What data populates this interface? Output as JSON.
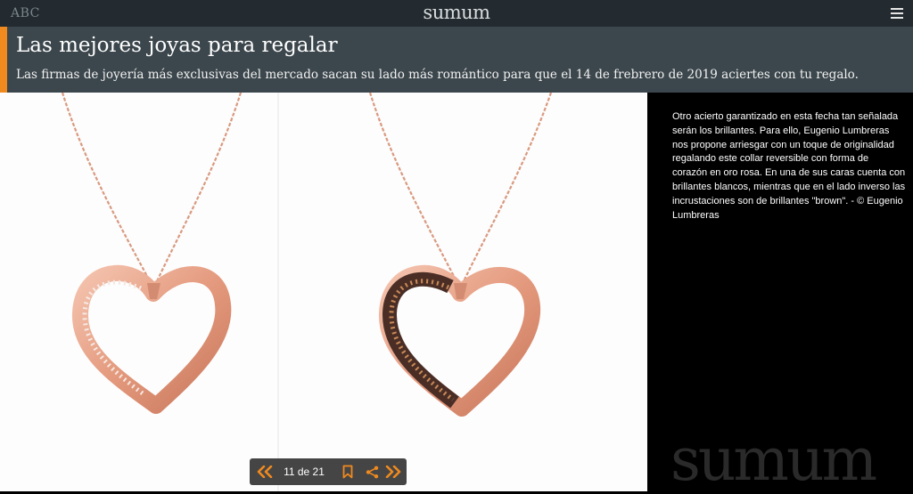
{
  "header": {
    "brand_left": "ABC",
    "brand_center": "sumum",
    "menu_icon": "hamburger-menu-icon"
  },
  "article": {
    "title": "Las mejores joyas para regalar",
    "subtitle": "Las firmas de joyería más exclusivas del mercado sacan su lado más romántico para que el 14 de frebrero de 2019 aciertes con tu regalo."
  },
  "gallery": {
    "caption": "Otro acierto garantizado en esta fecha tan señalada serán los brillantes. Para ello, Eugenio Lumbreras nos propone arriesgar con un toque de originalidad regalando este collar reversible con forma de corazón en oro rosa. En una de sus caras cuenta con brillantes blancos, mientras que en el lado inverso las incrustaciones son de brillantes \"brown\". - © Eugenio Lumbreras",
    "watermark": "sumum",
    "pager": {
      "current": 11,
      "total": 21,
      "label": "11 de 21",
      "prev_icon": "double-chevron-left-icon",
      "bookmark_icon": "bookmark-icon",
      "share_icon": "share-icon",
      "next_icon": "double-chevron-right-icon"
    }
  },
  "colors": {
    "accent": "#f08a1f",
    "topbar": "#232b30",
    "headline_band": "#3c474d",
    "rose_gold": "#e8a58c"
  }
}
